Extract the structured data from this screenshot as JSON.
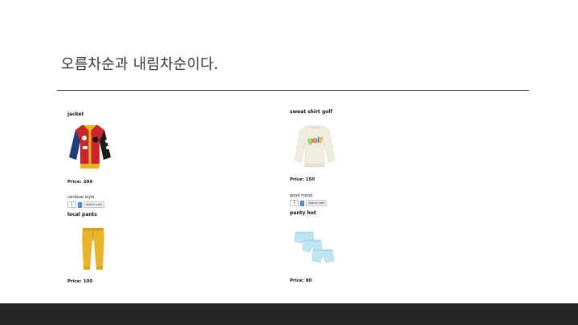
{
  "slide": {
    "title": "오름차순과 내림차순이다."
  },
  "products": [
    {
      "name": "jacket",
      "price": "Price: 200",
      "description": "rainbow style",
      "quantity": "1",
      "add_label": "Add to cart"
    },
    {
      "name": "sweat shirt golf",
      "price": "Price: 150",
      "description": "good mood",
      "quantity": "1",
      "add_label": "Add to cart"
    },
    {
      "name": "local pants",
      "price": "Price: 100"
    },
    {
      "name": "panty hot",
      "price": "Price: 80"
    }
  ],
  "colors": {
    "footer": "#262626",
    "accent": "#3a7bd5"
  }
}
